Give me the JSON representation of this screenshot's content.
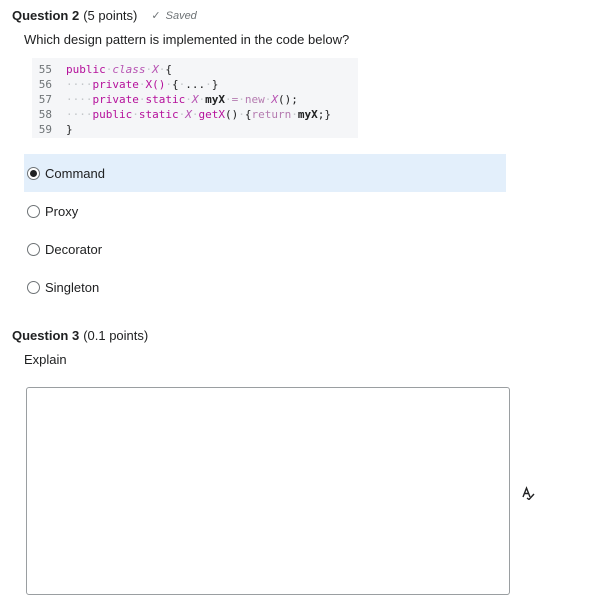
{
  "question2": {
    "number_label": "Question 2",
    "points_label": "(5 points)",
    "saved_label": "Saved",
    "prompt": "Which design pattern is implemented in the code below?",
    "code_lines": [
      {
        "line": "55",
        "tokens": [
          {
            "t": "public",
            "c": "kw"
          },
          {
            "t": "·",
            "c": "ws"
          },
          {
            "t": "class",
            "c": "ty"
          },
          {
            "t": "·",
            "c": "ws"
          },
          {
            "t": "X",
            "c": "ty"
          },
          {
            "t": "·",
            "c": "ws"
          },
          {
            "t": "{",
            "c": "pl"
          }
        ]
      },
      {
        "line": "56",
        "tokens": [
          {
            "t": "····",
            "c": "ws"
          },
          {
            "t": "private",
            "c": "kw"
          },
          {
            "t": "·",
            "c": "ws"
          },
          {
            "t": "X()",
            "c": "fn"
          },
          {
            "t": "·",
            "c": "ws"
          },
          {
            "t": "{",
            "c": "pl"
          },
          {
            "t": "·",
            "c": "ws"
          },
          {
            "t": "...",
            "c": "pl"
          },
          {
            "t": "·",
            "c": "ws"
          },
          {
            "t": "}",
            "c": "pl"
          }
        ]
      },
      {
        "line": "57",
        "tokens": [
          {
            "t": "····",
            "c": "ws"
          },
          {
            "t": "private",
            "c": "kw"
          },
          {
            "t": "·",
            "c": "ws"
          },
          {
            "t": "static",
            "c": "kw"
          },
          {
            "t": "·",
            "c": "ws"
          },
          {
            "t": "X",
            "c": "ty"
          },
          {
            "t": "·",
            "c": "ws"
          },
          {
            "t": "myX",
            "c": "id"
          },
          {
            "t": "·",
            "c": "ws"
          },
          {
            "t": "=",
            "c": "dim"
          },
          {
            "t": "·",
            "c": "ws"
          },
          {
            "t": "new",
            "c": "dim"
          },
          {
            "t": "·",
            "c": "ws"
          },
          {
            "t": "X",
            "c": "ty"
          },
          {
            "t": "();",
            "c": "pl"
          }
        ]
      },
      {
        "line": "58",
        "tokens": [
          {
            "t": "····",
            "c": "ws"
          },
          {
            "t": "public",
            "c": "kw"
          },
          {
            "t": "·",
            "c": "ws"
          },
          {
            "t": "static",
            "c": "kw"
          },
          {
            "t": "·",
            "c": "ws"
          },
          {
            "t": "X",
            "c": "ty"
          },
          {
            "t": "·",
            "c": "ws"
          },
          {
            "t": "getX",
            "c": "fn"
          },
          {
            "t": "()",
            "c": "pl"
          },
          {
            "t": "·",
            "c": "ws"
          },
          {
            "t": "{",
            "c": "pl"
          },
          {
            "t": "return",
            "c": "dim"
          },
          {
            "t": "·",
            "c": "ws"
          },
          {
            "t": "myX",
            "c": "id"
          },
          {
            "t": ";",
            "c": "pl"
          },
          {
            "t": "}",
            "c": "pl"
          }
        ]
      },
      {
        "line": "59",
        "tokens": [
          {
            "t": "}",
            "c": "pl"
          }
        ]
      }
    ],
    "options": [
      {
        "label": "Command",
        "selected": true
      },
      {
        "label": "Proxy",
        "selected": false
      },
      {
        "label": "Decorator",
        "selected": false
      },
      {
        "label": "Singleton",
        "selected": false
      }
    ]
  },
  "question3": {
    "number_label": "Question 3",
    "points_label": "(0.1 points)",
    "prompt": "Explain",
    "answer_value": ""
  },
  "icons": {
    "saved": "check-icon",
    "spellcheck": "spellcheck-icon"
  },
  "colors": {
    "selected_bg": "#e3effb",
    "keyword": "#b5109b",
    "code_bg": "#f5f6f8"
  }
}
